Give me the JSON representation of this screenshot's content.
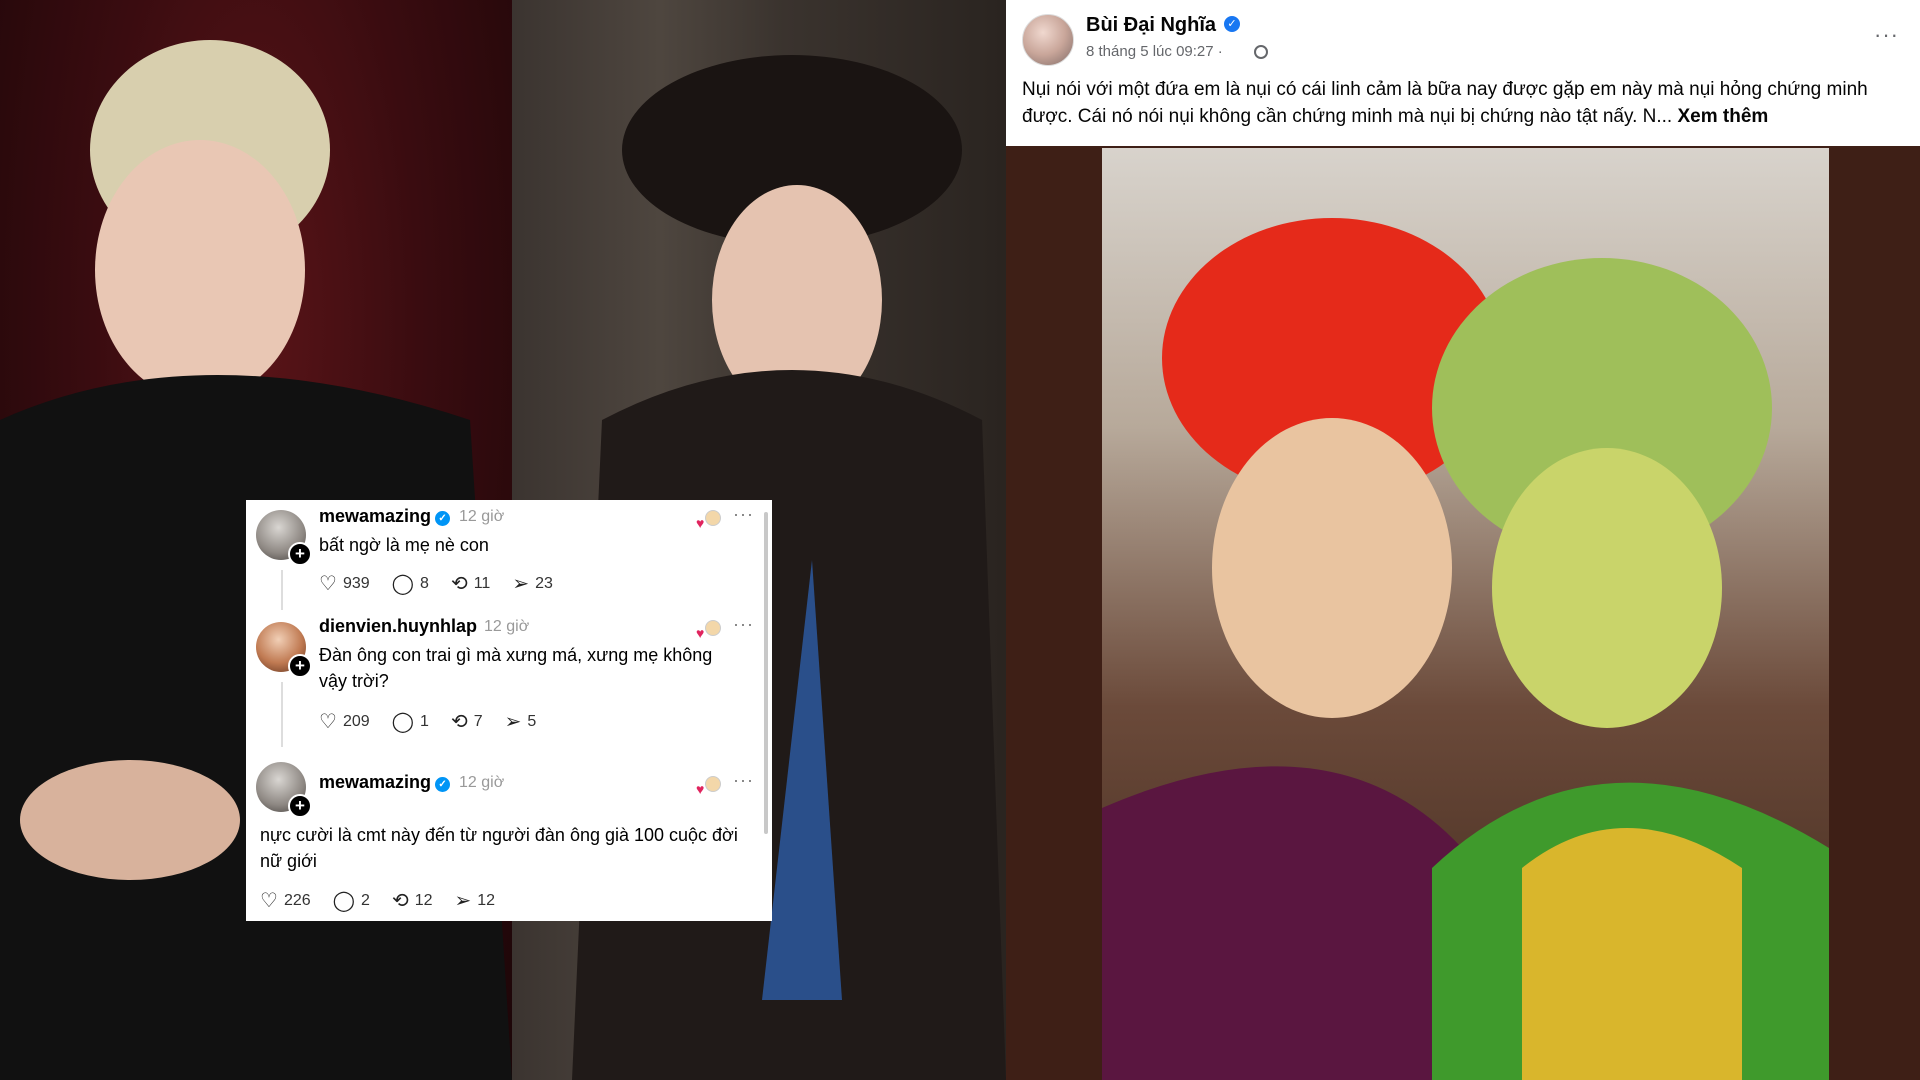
{
  "facebook_post": {
    "author": "Bùi Đại Nghĩa",
    "meta": "8 tháng 5 lúc 09:27 ·",
    "text": "Nụi nói với một đứa em là nụi có cái linh cảm là bữa nay được gặp em này mà nụi hỏng chứng minh được. Cái nó nói nụi không cần chứng minh mà nụi bị chứng nào tật nấy. N...",
    "see_more": "Xem thêm",
    "more_label": "···"
  },
  "threads": {
    "comments": [
      {
        "user": "mewamazing",
        "verified": true,
        "time": "12 giờ",
        "text": "bất ngờ là mẹ nè con",
        "likes": "939",
        "replies": "8",
        "reposts": "11",
        "shares": "23"
      },
      {
        "user": "dienvien.huynhlap",
        "verified": false,
        "time": "12 giờ",
        "text": "Đàn ông con trai gì mà xưng má, xưng mẹ không vậy trời?",
        "likes": "209",
        "replies": "1",
        "reposts": "7",
        "shares": "5"
      },
      {
        "user": "mewamazing",
        "verified": true,
        "time": "12 giờ",
        "text": "nực cười là cmt này đến từ người đàn ông già 100 cuộc đời nữ giới",
        "likes": "226",
        "replies": "2",
        "reposts": "12",
        "shares": "12"
      }
    ],
    "plus_label": "+",
    "dots_label": "···",
    "check_label": "✓"
  },
  "icons": {
    "like": "heart-icon",
    "reply": "comment-icon",
    "repost": "repost-icon",
    "share": "send-icon"
  }
}
